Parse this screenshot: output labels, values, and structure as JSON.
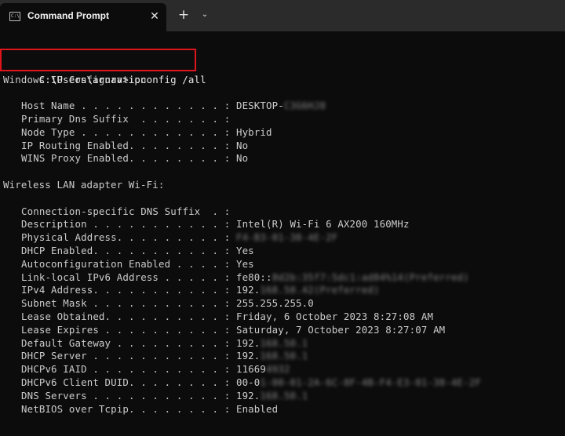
{
  "titlebar": {
    "tab_title": "Command Prompt",
    "tab_icon_text": "C:\\",
    "close_glyph": "✕",
    "new_tab_glyph": "+",
    "dropdown_glyph": "⌄"
  },
  "terminal": {
    "command": "C:\\Users\\arnav>ipconfig /all",
    "header": "Windows IP Configuration",
    "global": [
      {
        "label": "Host Name . . . . . . . . . . . . : ",
        "value": "DESKTOP-",
        "redacted": "C3G6HJ8"
      },
      {
        "label": "Primary Dns Suffix  . . . . . . . : ",
        "value": "",
        "redacted": ""
      },
      {
        "label": "Node Type . . . . . . . . . . . . : ",
        "value": "Hybrid",
        "redacted": ""
      },
      {
        "label": "IP Routing Enabled. . . . . . . . : ",
        "value": "No",
        "redacted": ""
      },
      {
        "label": "WINS Proxy Enabled. . . . . . . . : ",
        "value": "No",
        "redacted": ""
      }
    ],
    "adapter_header": "Wireless LAN adapter Wi-Fi:",
    "adapter": [
      {
        "label": "Connection-specific DNS Suffix  . : ",
        "value": "",
        "redacted": ""
      },
      {
        "label": "Description . . . . . . . . . . . : ",
        "value": "Intel(R) Wi-Fi 6 AX200 160MHz",
        "redacted": ""
      },
      {
        "label": "Physical Address. . . . . . . . . : ",
        "value": "",
        "redacted": "F4-B3-01-38-4E-2F"
      },
      {
        "label": "DHCP Enabled. . . . . . . . . . . : ",
        "value": "Yes",
        "redacted": ""
      },
      {
        "label": "Autoconfiguration Enabled . . . . : ",
        "value": "Yes",
        "redacted": ""
      },
      {
        "label": "Link-local IPv6 Address . . . . . : ",
        "value": "fe80::",
        "redacted": "8d2b:35f7:5dc1:ad84%14(Preferred)"
      },
      {
        "label": "IPv4 Address. . . . . . . . . . . : ",
        "value": "192.",
        "redacted": "168.50.42(Preferred)"
      },
      {
        "label": "Subnet Mask . . . . . . . . . . . : ",
        "value": "255.255.255.0",
        "redacted": ""
      },
      {
        "label": "Lease Obtained. . . . . . . . . . : ",
        "value": "Friday, 6 October 2023 8:27:08 AM",
        "redacted": ""
      },
      {
        "label": "Lease Expires . . . . . . . . . . : ",
        "value": "Saturday, 7 October 2023 8:27:07 AM",
        "redacted": ""
      },
      {
        "label": "Default Gateway . . . . . . . . . : ",
        "value": "192.",
        "redacted": "168.50.1"
      },
      {
        "label": "DHCP Server . . . . . . . . . . . : ",
        "value": "192.",
        "redacted": "168.50.1"
      },
      {
        "label": "DHCPv6 IAID . . . . . . . . . . . : ",
        "value": "11669",
        "redacted": "4932"
      },
      {
        "label": "DHCPv6 Client DUID. . . . . . . . : ",
        "value": "00-0",
        "redacted": "1-00-01-2A-6C-8F-4B-F4-E3-01-38-4E-2F"
      },
      {
        "label": "DNS Servers . . . . . . . . . . . : ",
        "value": "192.",
        "redacted": "168.50.1"
      },
      {
        "label": "NetBIOS over Tcpip. . . . . . . . : ",
        "value": "Enabled",
        "redacted": ""
      }
    ]
  }
}
